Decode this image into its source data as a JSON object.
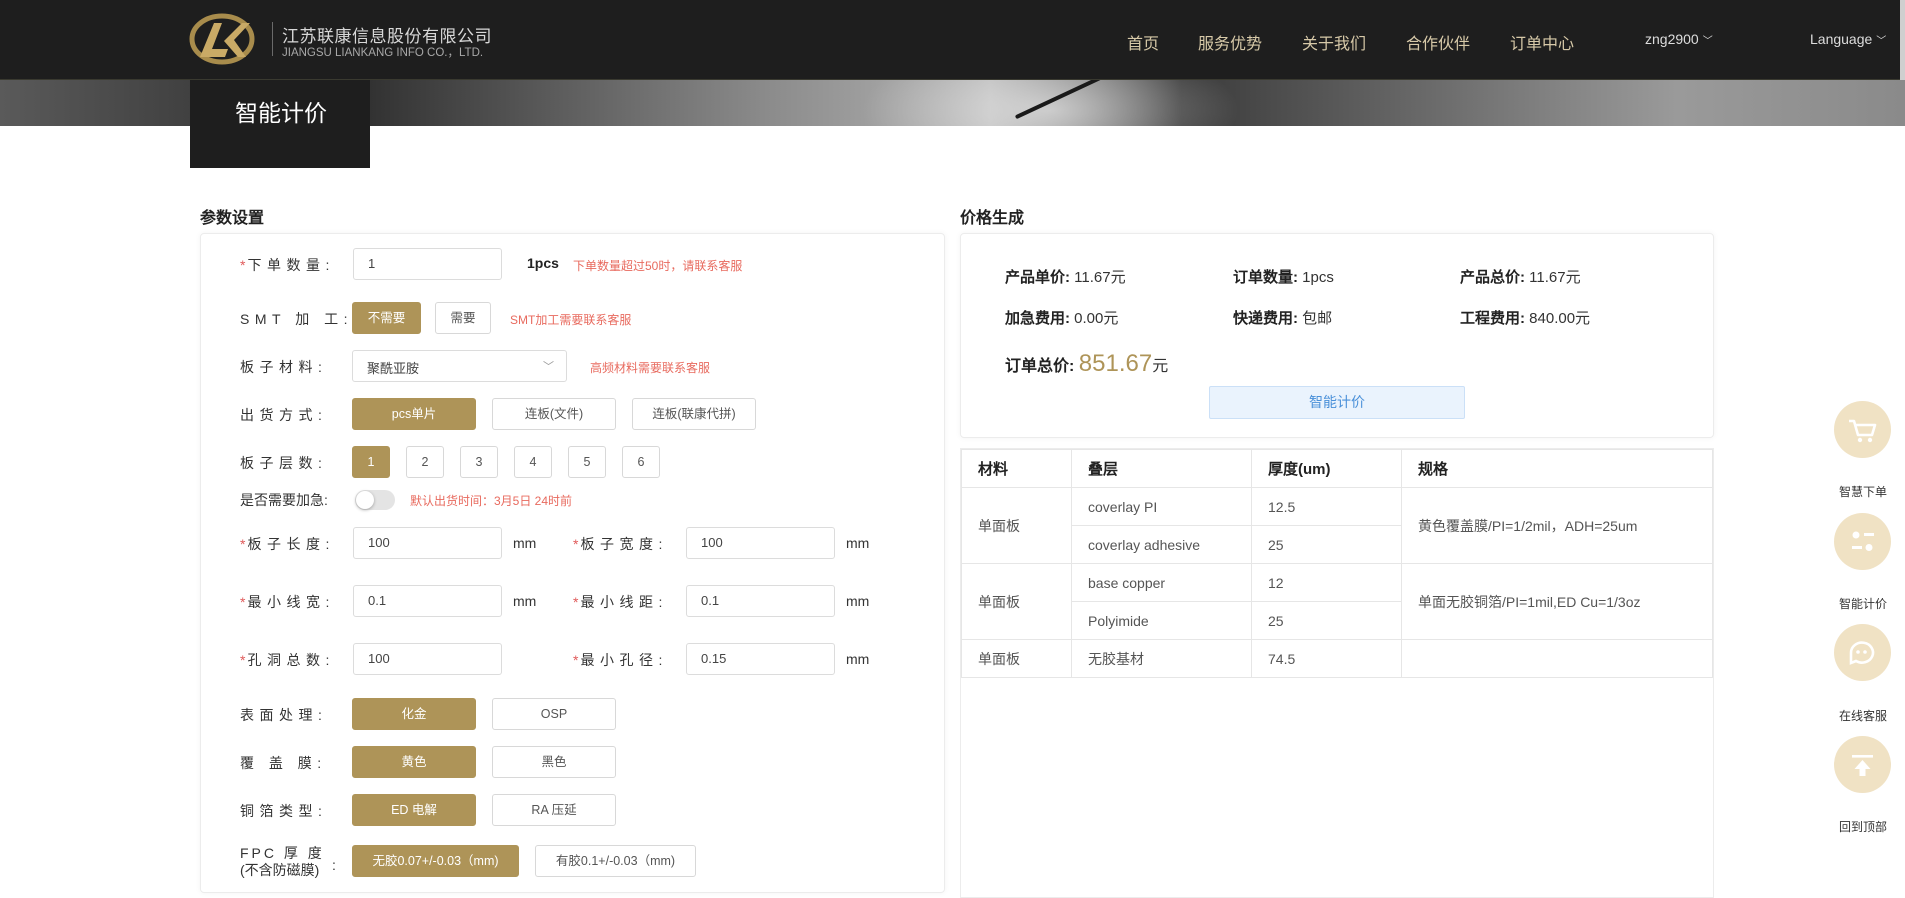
{
  "header": {
    "company_name": "江苏联康信息股份有限公司",
    "company_name_en": "JIANGSU LIANKANG INFO CO.，LTD.",
    "nav": [
      "首页",
      "服务优势",
      "关于我们",
      "合作伙伴",
      "订单中心"
    ],
    "user": "zng2900",
    "language": "Language"
  },
  "page_title": "智能计价",
  "params": {
    "section_title": "参数设置",
    "quantity": {
      "label": "下单数量:",
      "value": "1",
      "unit_display": "1pcs",
      "hint": "下单数量超过50时，请联系客服"
    },
    "smt": {
      "label": "SMT 加 工:",
      "options": [
        "不需要",
        "需要"
      ],
      "selected": "不需要",
      "hint": "SMT加工需要联系客服"
    },
    "material": {
      "label": "板子材料:",
      "value": "聚酰亚胺",
      "hint": "高频材料需要联系客服"
    },
    "shipping": {
      "label": "出货方式:",
      "options": [
        "pcs单片",
        "连板(文件)",
        "连板(联康代拼)"
      ],
      "selected": "pcs单片"
    },
    "layers": {
      "label": "板子层数:",
      "options": [
        "1",
        "2",
        "3",
        "4",
        "5",
        "6"
      ],
      "selected": "1"
    },
    "urgent": {
      "label": "是否需要加急:",
      "enabled": false,
      "hint": "默认出货时间：3月5日 24时前"
    },
    "length": {
      "label": "板子长度:",
      "value": "100",
      "unit": "mm"
    },
    "width": {
      "label": "板子宽度:",
      "value": "100",
      "unit": "mm"
    },
    "min_trace": {
      "label": "最小线宽:",
      "value": "0.1",
      "unit": "mm"
    },
    "min_space": {
      "label": "最小线距:",
      "value": "0.1",
      "unit": "mm"
    },
    "holes": {
      "label": "孔洞总数:",
      "value": "100"
    },
    "min_hole": {
      "label": "最小孔径:",
      "value": "0.15",
      "unit": "mm"
    },
    "surface": {
      "label": "表面处理:",
      "options": [
        "化金",
        "OSP"
      ],
      "selected": "化金"
    },
    "coverlay": {
      "label": "覆 盖 膜:",
      "options": [
        "黄色",
        "黑色"
      ],
      "selected": "黄色"
    },
    "copper": {
      "label": "铜箔类型:",
      "options": [
        "ED 电解",
        "RA 压延"
      ],
      "selected": "ED 电解"
    },
    "fpc_thickness": {
      "label_line1": "FPC 厚 度",
      "label_line2": "(不含防磁膜)",
      "colon": ":",
      "options": [
        "无胶0.07+/-0.03（mm)",
        "有胶0.1+/-0.03（mm)"
      ],
      "selected": "无胶0.07+/-0.03（mm)"
    }
  },
  "price": {
    "section_title": "价格生成",
    "unit_price_label": "产品单价:",
    "unit_price": "11.67元",
    "qty_label": "订单数量:",
    "qty": "1pcs",
    "product_total_label": "产品总价:",
    "product_total": "11.67元",
    "urgent_fee_label": "加急费用:",
    "urgent_fee": "0.00元",
    "delivery_fee_label": "快递费用:",
    "delivery_fee": "包邮",
    "eng_fee_label": "工程费用:",
    "eng_fee": "840.00元",
    "order_total_label": "订单总价:",
    "order_total": "851.67",
    "order_total_unit": "元",
    "calc_button": "智能计价"
  },
  "stackup": {
    "headers": [
      "材料",
      "叠层",
      "厚度(um)",
      "规格"
    ],
    "rows": [
      {
        "material": "单面板",
        "layers": [
          [
            "coverlay PI",
            "12.5"
          ],
          [
            "coverlay adhesive",
            "25"
          ]
        ],
        "spec": "黄色覆盖膜/PI=1/2mil，ADH=25um"
      },
      {
        "material": "单面板",
        "layers": [
          [
            "base copper",
            "12"
          ],
          [
            "Polyimide",
            "25"
          ]
        ],
        "spec": "单面无胶铜箔/PI=1mil,ED Cu=1/3oz"
      },
      {
        "material": "单面板",
        "layers": [
          [
            "无胶基材",
            "74.5"
          ]
        ],
        "spec": ""
      }
    ]
  },
  "sidebar": [
    {
      "label": "智慧下单",
      "icon": "cart-icon"
    },
    {
      "label": "智能计价",
      "icon": "calculator-icon"
    },
    {
      "label": "在线客服",
      "icon": "chat-icon"
    },
    {
      "label": "回到顶部",
      "icon": "back-to-top-icon"
    }
  ]
}
